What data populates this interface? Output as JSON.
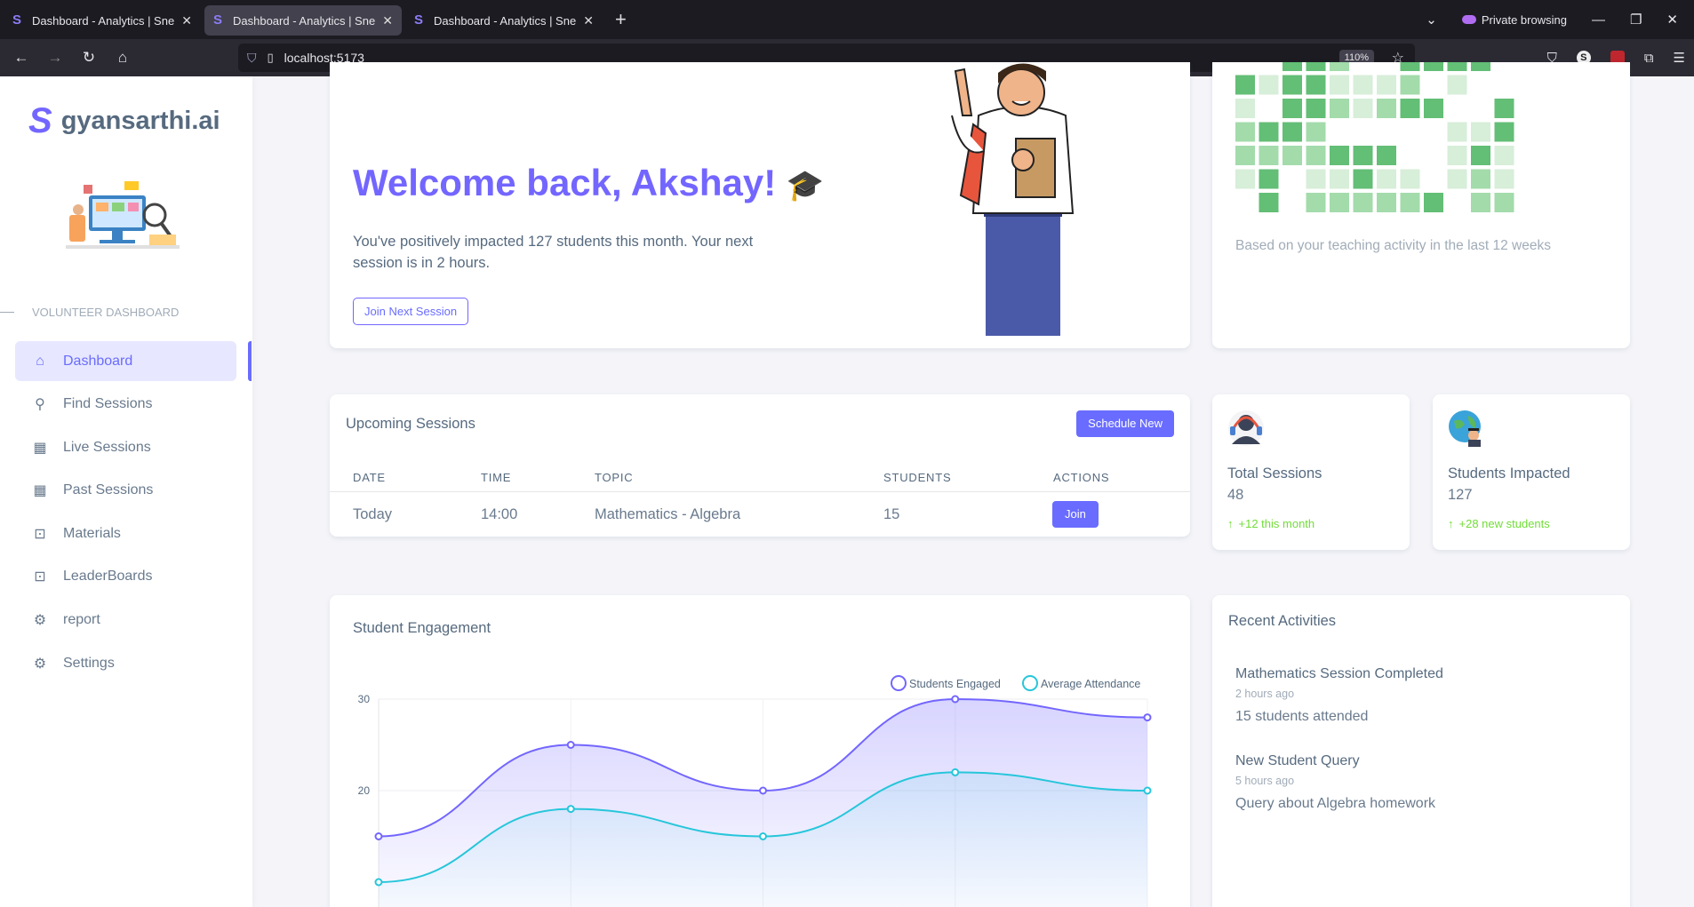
{
  "browser": {
    "tabs": [
      {
        "title": "Dashboard - Analytics | Sneat -",
        "active": false
      },
      {
        "title": "Dashboard - Analytics | Sneat -",
        "active": true
      },
      {
        "title": "Dashboard - Analytics | Sneat -",
        "active": false
      }
    ],
    "private_label": "Private browsing",
    "url": "localhost:5173",
    "zoom": "110%"
  },
  "sidebar": {
    "brand": "gyansarthi.ai",
    "section_header": "VOLUNTEER DASHBOARD",
    "items": [
      {
        "label": "Dashboard",
        "icon": "home-icon",
        "active": true
      },
      {
        "label": "Find Sessions",
        "icon": "search-icon",
        "active": false
      },
      {
        "label": "Live Sessions",
        "icon": "calendar-icon",
        "active": false
      },
      {
        "label": "Past Sessions",
        "icon": "calendar-icon",
        "active": false
      },
      {
        "label": "Materials",
        "icon": "chart-box-icon",
        "active": false
      },
      {
        "label": "LeaderBoards",
        "icon": "chart-box-icon",
        "active": false
      },
      {
        "label": "report",
        "icon": "gear-icon",
        "active": false
      },
      {
        "label": "Settings",
        "icon": "gear-icon",
        "active": false
      }
    ]
  },
  "welcome": {
    "title": "Welcome back, Akshay!",
    "message": "You've positively impacted 127 students this month. Your next session is in 2 hours.",
    "button": "Join Next Session"
  },
  "activity_heatmap": {
    "note": "Based on your teaching activity in the last 12 weeks",
    "levels": [
      [
        0,
        0,
        3,
        3,
        2,
        0,
        0,
        3,
        3,
        3,
        3,
        0
      ],
      [
        3,
        1,
        3,
        3,
        1,
        1,
        1,
        2,
        0,
        1,
        0,
        0
      ],
      [
        1,
        0,
        3,
        3,
        2,
        1,
        2,
        3,
        3,
        0,
        0,
        3
      ],
      [
        2,
        3,
        3,
        2,
        0,
        0,
        0,
        0,
        0,
        1,
        1,
        3
      ],
      [
        2,
        2,
        2,
        2,
        3,
        3,
        3,
        0,
        0,
        1,
        3,
        1
      ],
      [
        1,
        3,
        0,
        1,
        1,
        3,
        1,
        1,
        0,
        1,
        2,
        1
      ],
      [
        0,
        3,
        0,
        2,
        2,
        2,
        2,
        2,
        3,
        0,
        2,
        2
      ]
    ],
    "colors": [
      "#ffffff",
      "#d7eed9",
      "#a3dbab",
      "#63be76"
    ]
  },
  "upcoming": {
    "title": "Upcoming Sessions",
    "schedule_button": "Schedule New",
    "columns": [
      "DATE",
      "TIME",
      "TOPIC",
      "STUDENTS",
      "ACTIONS"
    ],
    "rows": [
      {
        "date": "Today",
        "time": "14:00",
        "topic": "Mathematics - Algebra",
        "students": "15",
        "action": "Join"
      }
    ]
  },
  "stats": [
    {
      "label": "Total Sessions",
      "value": "48",
      "delta": "+12 this month",
      "icon": "headset-user-icon"
    },
    {
      "label": "Students Impacted",
      "value": "127",
      "delta": "+28 new students",
      "icon": "globe-student-icon"
    }
  ],
  "engagement": {
    "title": "Student Engagement"
  },
  "chart_data": {
    "type": "area",
    "title": "Student Engagement",
    "x": [
      0,
      1,
      2,
      3,
      4
    ],
    "y_ticks": [
      20,
      30
    ],
    "series": [
      {
        "name": "Students Engaged",
        "values": [
          15,
          25,
          20,
          30,
          28
        ],
        "color": "#7366ff"
      },
      {
        "name": "Average Attendance",
        "values": [
          10,
          18,
          15,
          22,
          20
        ],
        "color": "#26c6da"
      }
    ],
    "legend": "top-right",
    "grid": true
  },
  "recent": {
    "title": "Recent Activities",
    "items": [
      {
        "title": "Mathematics Session Completed",
        "time": "2 hours ago",
        "detail": "15 students attended"
      },
      {
        "title": "New Student Query",
        "time": "5 hours ago",
        "detail": "Query about Algebra homework"
      }
    ]
  }
}
